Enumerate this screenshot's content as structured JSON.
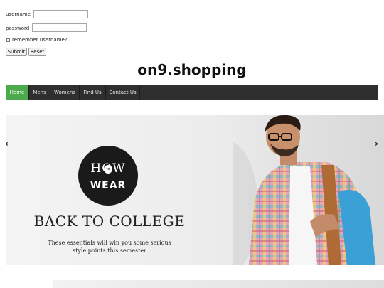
{
  "login": {
    "username_label": "username",
    "password_label": "password",
    "remember_label": "remember username?",
    "submit_label": "Submit",
    "reset_label": "Reset"
  },
  "site": {
    "title": "on9.shopping"
  },
  "nav": {
    "items": [
      "Home",
      "Mens",
      "Womens",
      "Find Us",
      "Contact Us"
    ],
    "active": "Home",
    "active_color": "#4caa4c",
    "bar_color": "#2f2f2f"
  },
  "slider": {
    "prev_arrow": "‹",
    "next_arrow": "›",
    "badge_how": "HOW",
    "badge_to": "to",
    "badge_wear": "WEAR",
    "headline": "BACK TO COLLEGE",
    "subtext_line1": "These essentials will win you some serious",
    "subtext_line2": "style points this semester"
  }
}
